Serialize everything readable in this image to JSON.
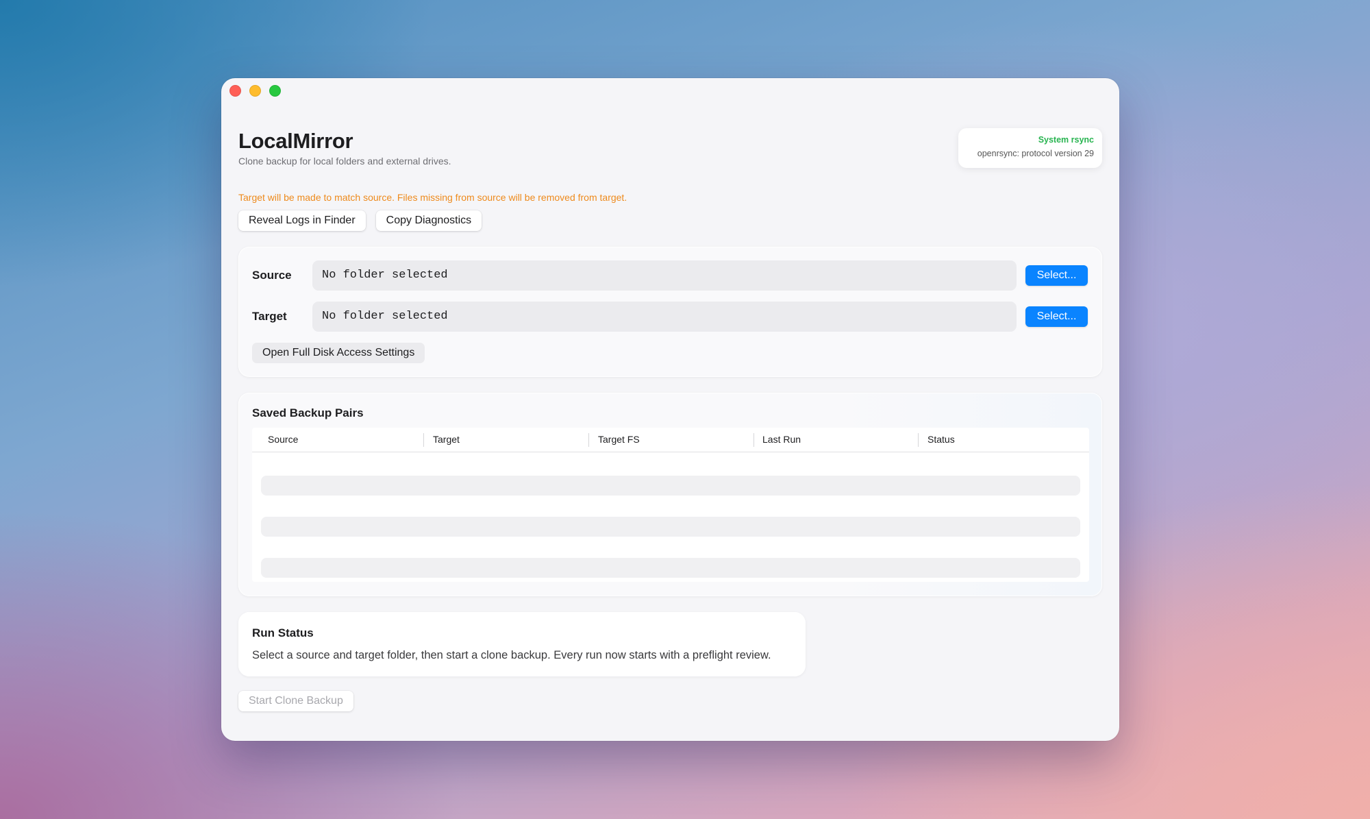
{
  "window": {
    "traffic_lights": {
      "close_color": "#ff5f57",
      "minimize_color": "#febc2e",
      "zoom_color": "#28c840"
    }
  },
  "header": {
    "title": "LocalMirror",
    "subtitle": "Clone backup for local folders and external drives."
  },
  "rsync": {
    "label": "System rsync",
    "version": "openrsync: protocol version 29",
    "label_color": "#28b450"
  },
  "warning": {
    "text": "Target will be made to match source. Files missing from source will be removed from target.",
    "color": "#ee8a1c"
  },
  "toolbar": {
    "reveal_logs_label": "Reveal Logs in Finder",
    "copy_diagnostics_label": "Copy Diagnostics"
  },
  "folders": {
    "source": {
      "label": "Source",
      "value": "No folder selected",
      "button_label": "Select..."
    },
    "target": {
      "label": "Target",
      "value": "No folder selected",
      "button_label": "Select..."
    },
    "full_disk_access_label": "Open Full Disk Access Settings",
    "accent_color": "#0a84ff"
  },
  "saved_pairs": {
    "title": "Saved Backup Pairs",
    "columns": [
      "Source",
      "Target",
      "Target FS",
      "Last Run",
      "Status"
    ],
    "rows": []
  },
  "run_status": {
    "title": "Run Status",
    "message": "Select a source and target folder, then start a clone backup. Every run now starts with a preflight review."
  },
  "start_button": {
    "label": "Start Clone Backup",
    "enabled": false
  }
}
